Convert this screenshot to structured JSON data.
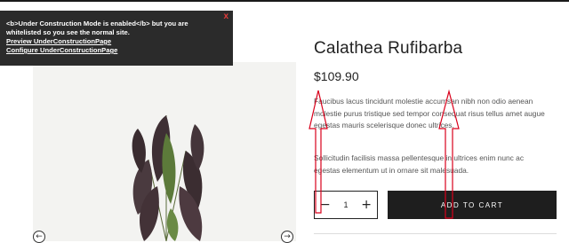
{
  "notice": {
    "message": "<b>Under Construction Mode is enabled</b> but you are whitelisted so you see the normal site.",
    "preview_link": "Preview UnderConstructionPage",
    "configure_link": "Configure UnderConstructionPage",
    "close_label": "x"
  },
  "product": {
    "title": "Calathea Rufibarba",
    "price": "$109.90",
    "description_1": "Faucibus lacus tincidunt molestie accumsan nibh non odio aenean molestie purus tristique sed tempor consequat risus tellus amet augue egestas mauris scelerisque donec ultrices.",
    "description_2": "Sollicitudin facilisis massa pellentesque in ultrices enim nunc ac egestas elementum ut in ornare sit malesuada.",
    "quantity": "1",
    "add_to_cart": "ADD TO CART"
  },
  "icons": {
    "minus": "−",
    "plus": "+",
    "prev": "←",
    "next": "→"
  },
  "colors": {
    "notice_bg": "#2b2b2b",
    "close_x": "#e23b3b",
    "button_bg": "#1e1e1e",
    "annotation_arrow": "#d9001b"
  }
}
